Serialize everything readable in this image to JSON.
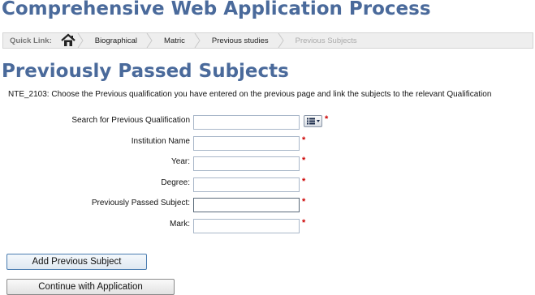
{
  "app": {
    "title": "Comprehensive Web Application Process"
  },
  "breadcrumb": {
    "quick_link_label": "Quick Link:",
    "items": [
      {
        "label": "Biographical",
        "enabled": true
      },
      {
        "label": "Matric",
        "enabled": true
      },
      {
        "label": "Previous studies",
        "enabled": true
      },
      {
        "label": "Previous Subjects",
        "enabled": false
      }
    ]
  },
  "page": {
    "title": "Previously Passed Subjects",
    "instruction": "NTE_2103: Choose the Previous qualification you have entered on the previous page and link the subjects to the relevant Qualification"
  },
  "form": {
    "required_marker": "*",
    "fields": {
      "search_qualification": {
        "label": "Search for Previous Qualification",
        "value": ""
      },
      "institution_name": {
        "label": "Institution Name",
        "value": ""
      },
      "year": {
        "label": "Year:",
        "value": ""
      },
      "degree": {
        "label": "Degree:",
        "value": ""
      },
      "passed_subject": {
        "label": "Previously Passed Subject:",
        "value": ""
      },
      "mark": {
        "label": "Mark:",
        "value": ""
      }
    }
  },
  "buttons": {
    "add_subject": "Add Previous Subject",
    "continue": "Continue with Application"
  },
  "colors": {
    "title": "#4a6a9b",
    "required": "#cc0000",
    "breadcrumb_bg": "#eeeeee",
    "disabled_text": "#aaaaaa"
  },
  "icons": {
    "home": "home-icon",
    "lookup": "list-dropdown-icon"
  }
}
